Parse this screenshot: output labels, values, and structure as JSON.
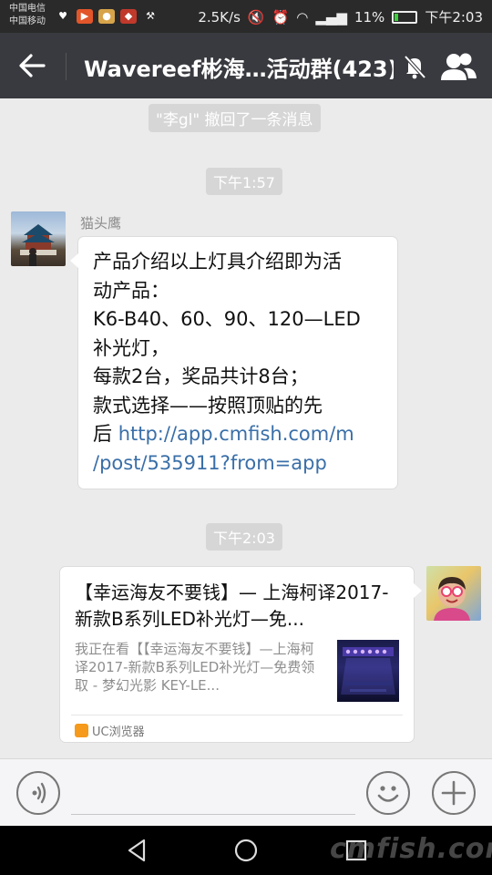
{
  "status_bar": {
    "carrier_1": "中国电信",
    "carrier_2": "中国移动",
    "net_speed": "2.5K/s",
    "battery": "11%",
    "time": "下午2:03"
  },
  "header": {
    "title": "Wavereef彬海…活动群(423)",
    "back_icon": "arrow-left-icon",
    "mute_icon": "bell-off-icon",
    "members_icon": "group-icon"
  },
  "chat": {
    "recall_notice": "\"李gl\" 撤回了一条消息",
    "timestamp_1": "下午1:57",
    "timestamp_2": "下午2:03",
    "message_1": {
      "sender": "猫头鹰",
      "line_1": "产品介绍以上灯具介绍即为活",
      "line_2": "动产品：",
      "line_3": "K6-B40、60、90、120—LED",
      "line_4": "补光灯，",
      "line_5": "每款2台，奖品共计8台；",
      "line_6": "款式选择——按照顶贴的先",
      "line_7_prefix": "后 ",
      "link_1": "http://app.cmfish.com/m",
      "link_2": "/post/535911?from=app"
    },
    "message_2": {
      "card_title": "【幸运海友不要钱】— 上海柯译2017-新款B系列LED补光灯—免...",
      "card_desc": "我正在看【【幸运海友不要钱】—上海柯译2017-新款B系列LED补光灯—免费领取 - 梦幻光影 KEY-LE...",
      "source": "UC浏览器"
    }
  },
  "input_bar": {
    "voice_icon": "voice-icon",
    "emoji_icon": "smiley-icon",
    "plus_icon": "plus-icon"
  },
  "nav_bar": {
    "watermark": "cmfish.com"
  },
  "colors": {
    "title_bar": "#393a3f",
    "chat_bg": "#ebebeb",
    "link": "#3a6fa8",
    "system_pill": "#d6d6d6"
  }
}
